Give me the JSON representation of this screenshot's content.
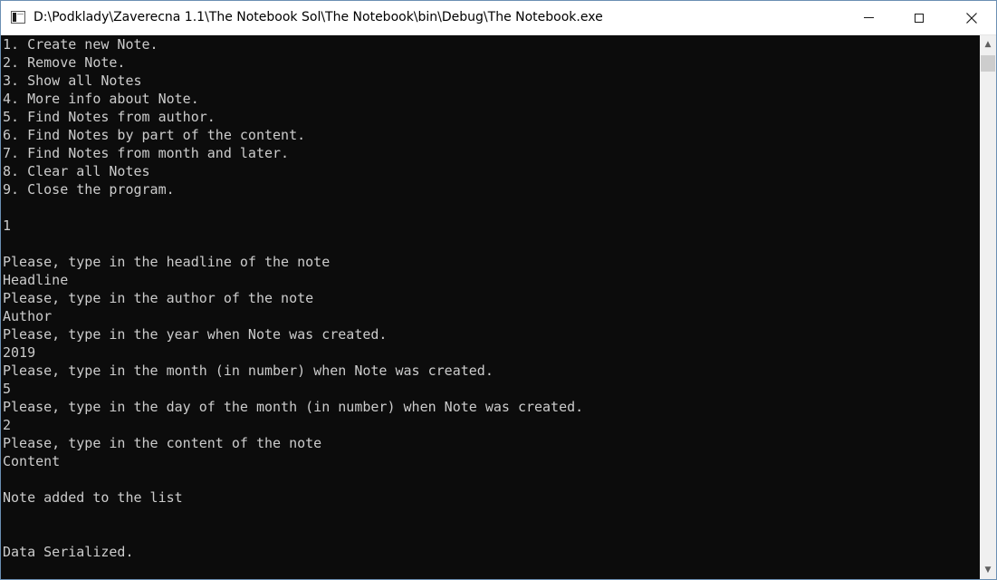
{
  "window": {
    "title": "D:\\Podklady\\Zaverecna 1.1\\The Notebook Sol\\The Notebook\\bin\\Debug\\The Notebook.exe",
    "controls": {
      "minimize": "minimize-icon",
      "maximize": "maximize-icon",
      "close": "close-icon",
      "close_glyph": "✕"
    }
  },
  "scrollbar": {
    "up_glyph": "▲",
    "down_glyph": "▼",
    "position": 0
  },
  "console": {
    "lines": [
      "1. Create new Note.",
      "2. Remove Note.",
      "3. Show all Notes",
      "4. More info about Note.",
      "5. Find Notes from author.",
      "6. Find Notes by part of the content.",
      "7. Find Notes from month and later.",
      "8. Clear all Notes",
      "9. Close the program.",
      "",
      "1",
      "",
      "Please, type in the headline of the note",
      "Headline",
      "Please, type in the author of the note",
      "Author",
      "Please, type in the year when Note was created.",
      "2019",
      "Please, type in the month (in number) when Note was created.",
      "5",
      "Please, type in the day of the month (in number) when Note was created.",
      "2",
      "Please, type in the content of the note",
      "Content",
      "",
      "Note added to the list",
      "",
      "",
      "Data Serialized."
    ]
  }
}
